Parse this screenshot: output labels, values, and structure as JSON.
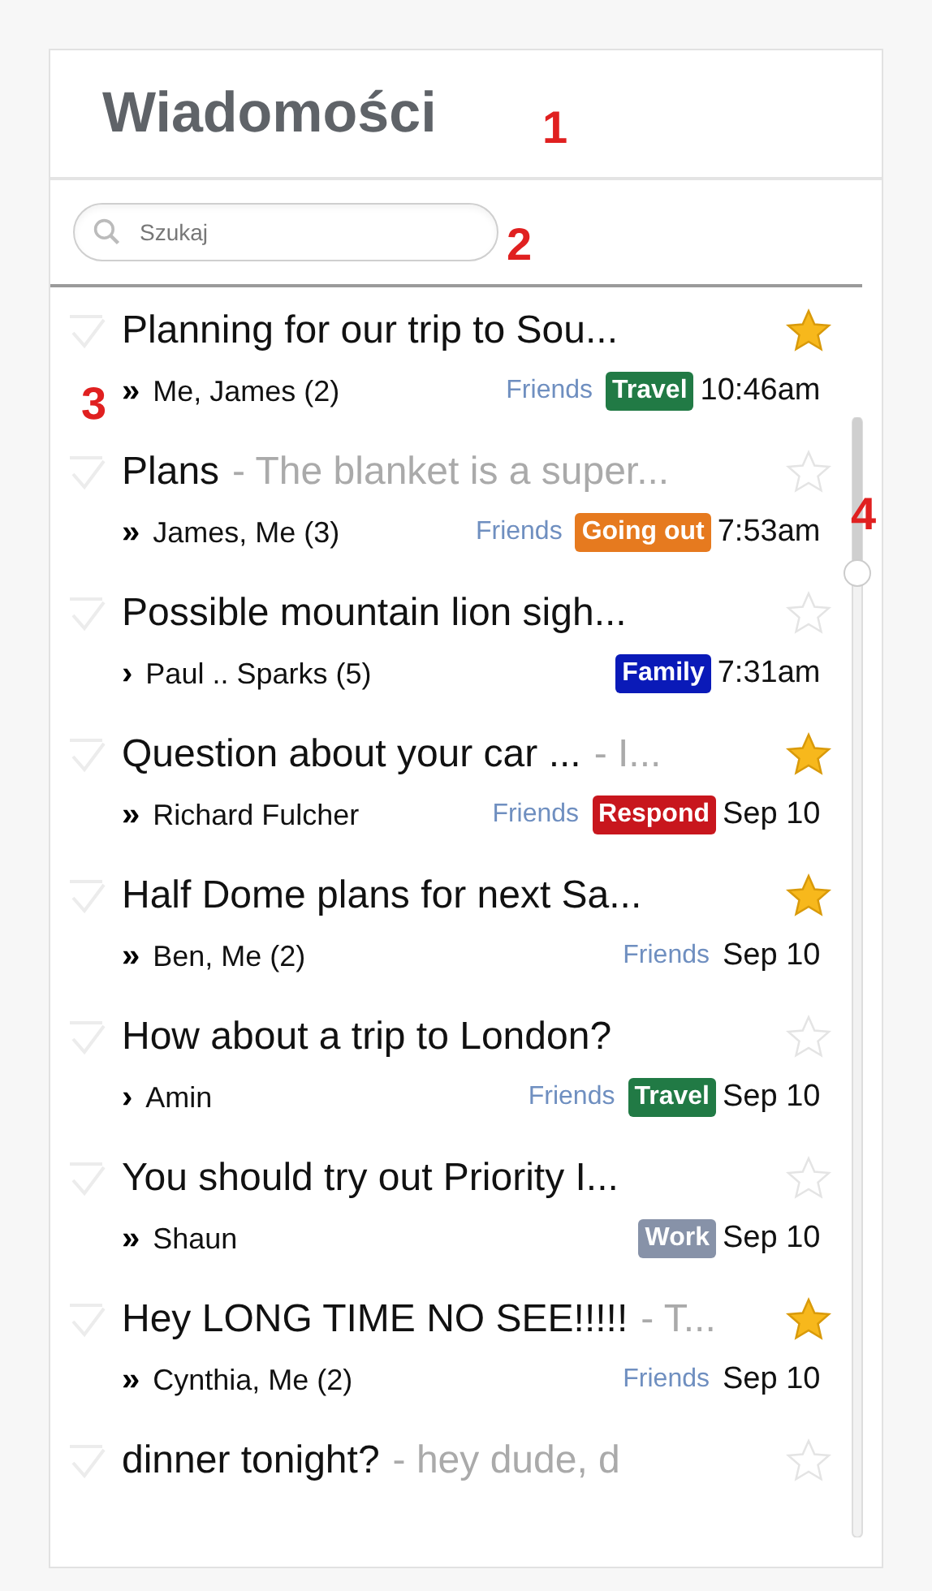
{
  "header": {
    "title": "Wiadomości"
  },
  "search": {
    "placeholder": "Szukaj"
  },
  "annotations": [
    {
      "label": "1"
    },
    {
      "label": "2"
    },
    {
      "label": "3"
    },
    {
      "label": "4"
    }
  ],
  "messages": [
    {
      "subject": "Planning for our trip to Sou...",
      "thread_mark": "»",
      "senders": "Me, James (2)",
      "labels": [
        {
          "kind": "text",
          "text": "Friends"
        },
        {
          "kind": "badge",
          "text": "Travel",
          "color": "#217a45"
        }
      ],
      "time": "10:46am",
      "starred": true
    },
    {
      "subject": "Plans",
      "snippet": "- The blanket is a super...",
      "thread_mark": "»",
      "senders": "James, Me (3)",
      "labels": [
        {
          "kind": "text",
          "text": "Friends"
        },
        {
          "kind": "badge",
          "text": "Going out",
          "color": "#e67a1f"
        }
      ],
      "time": "7:53am",
      "starred": false
    },
    {
      "subject": "Possible mountain lion sigh...",
      "thread_mark": "›",
      "senders": "Paul .. Sparks (5)",
      "labels": [
        {
          "kind": "badge",
          "text": "Family",
          "color": "#0a1ab8"
        }
      ],
      "time": "7:31am",
      "starred": false
    },
    {
      "subject": "Question about your car ...",
      "snippet": "- I...",
      "thread_mark": "»",
      "senders": "Richard Fulcher",
      "labels": [
        {
          "kind": "text",
          "text": "Friends"
        },
        {
          "kind": "badge",
          "text": "Respond",
          "color": "#c8161d"
        }
      ],
      "time": "Sep 10",
      "starred": true
    },
    {
      "subject": "Half Dome plans for next Sa...",
      "thread_mark": "»",
      "senders": "Ben, Me (2)",
      "labels": [
        {
          "kind": "text",
          "text": "Friends"
        }
      ],
      "time": "Sep 10",
      "starred": true
    },
    {
      "subject": "How about a trip to London?",
      "thread_mark": "›",
      "senders": "Amin",
      "labels": [
        {
          "kind": "text",
          "text": "Friends"
        },
        {
          "kind": "badge",
          "text": "Travel",
          "color": "#217a45"
        }
      ],
      "time": "Sep 10",
      "starred": false
    },
    {
      "subject": "You should try out Priority I...",
      "thread_mark": "»",
      "senders": "Shaun",
      "labels": [
        {
          "kind": "badge",
          "text": "Work",
          "color": "#8792a8"
        }
      ],
      "time": "Sep 10",
      "starred": false
    },
    {
      "subject": "Hey LONG TIME NO SEE!!!!!",
      "snippet": "- T...",
      "thread_mark": "»",
      "senders": "Cynthia, Me (2)",
      "labels": [
        {
          "kind": "text",
          "text": "Friends"
        }
      ],
      "time": "Sep 10",
      "starred": true
    },
    {
      "subject": "dinner tonight?",
      "snippet": "- hey dude, d",
      "starred": false
    }
  ]
}
